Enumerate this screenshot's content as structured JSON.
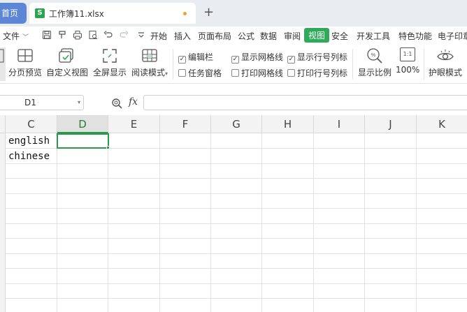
{
  "tabs": {
    "home_label": "首页",
    "document_name": "工作簿11.xlsx",
    "sheet_icon_letter": "S",
    "add_tab_symbol": "+"
  },
  "menu": {
    "file_label": "文件",
    "items": [
      "开始",
      "插入",
      "页面布局",
      "公式",
      "数据",
      "审阅",
      "视图",
      "安全",
      "开发工具",
      "特色功能",
      "电子印章"
    ],
    "active_item": "视图",
    "active_color": "#2eaa5a"
  },
  "ribbon": {
    "buttons": [
      "分页预览",
      "自定义视图",
      "全屏显示",
      "阅读模式"
    ],
    "reading_mode_dropdown": "▾",
    "checkboxes": [
      {
        "label": "编辑栏",
        "checked": true
      },
      {
        "label": "任务窗格",
        "checked": false
      },
      {
        "label": "显示网格线",
        "checked": true
      },
      {
        "label": "打印网格线",
        "checked": false
      },
      {
        "label": "显示行号列标",
        "checked": true
      },
      {
        "label": "打印行号列标",
        "checked": false
      }
    ],
    "zoom_label": "显示比例",
    "zoom_100_label": "100%",
    "zoom_100_icon_text": "1:1",
    "eye_protection_label": "护眼模式"
  },
  "formula_bar": {
    "cell_reference": "D1",
    "fx_label": "fx",
    "formula_value": ""
  },
  "grid": {
    "columns": [
      "C",
      "D",
      "E",
      "F",
      "G",
      "H",
      "I",
      "J",
      "K"
    ],
    "selected_column": "D",
    "cells": {
      "C1": "english",
      "C2": "chinese"
    },
    "selection_color": "#2a9a4a"
  }
}
